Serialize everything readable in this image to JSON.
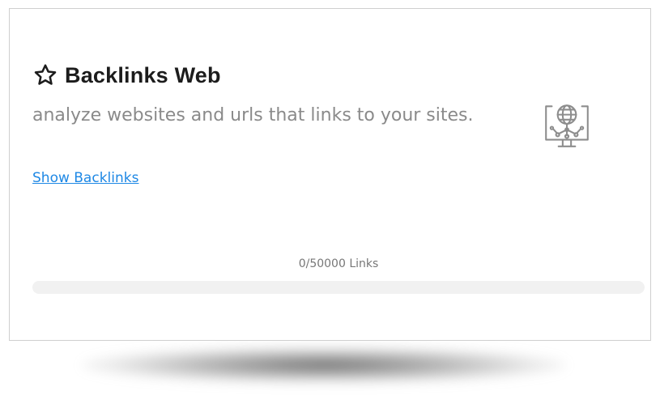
{
  "card": {
    "title": "Backlinks Web",
    "title_icon": "star-outline-icon",
    "description": "analyze websites and urls that links to your sites.",
    "link_label": "Show Backlinks",
    "illustration_icon": "monitor-globe-network-icon",
    "progress": {
      "label": "0/50000 Links",
      "fraction": 0
    }
  },
  "colors": {
    "title": "#1c1c1c",
    "description": "#8a8a8a",
    "link": "#1e88e5",
    "progress_track": "#f1f1f1"
  }
}
